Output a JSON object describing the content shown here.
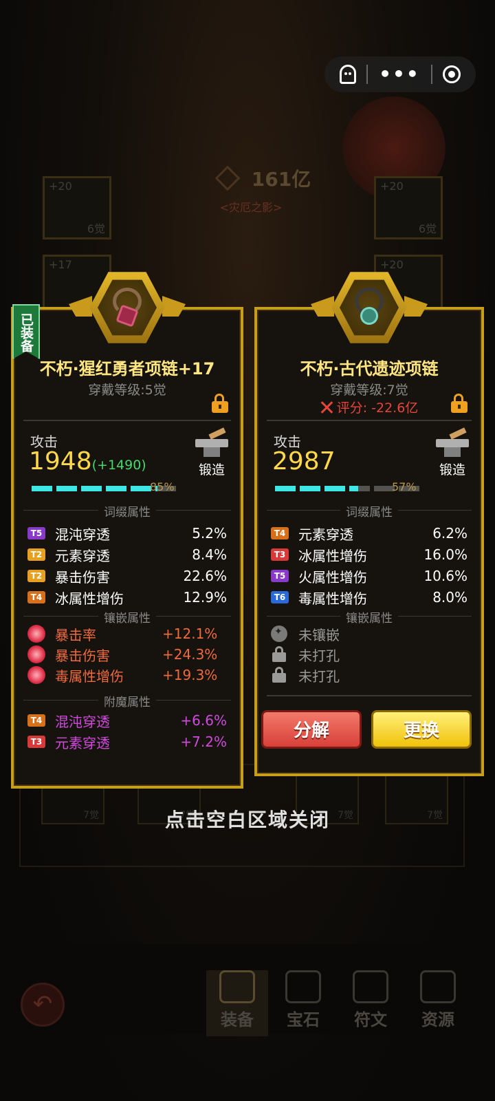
{
  "system_capsule": {
    "ghost": "ghost-icon",
    "more": "•••",
    "target": "target-icon"
  },
  "background": {
    "power_value": "161亿",
    "title": "<灾厄之影>",
    "slots": [
      {
        "level": "+20",
        "jue": "6觉"
      },
      {
        "level": "+20",
        "jue": "6觉"
      },
      {
        "level": "+17",
        "jue": ""
      },
      {
        "level": "+20",
        "jue": ""
      }
    ],
    "bottom_slots": [
      {
        "jue": "7觉"
      },
      {
        "jue": "7觉"
      },
      {
        "jue": "7觉"
      },
      {
        "jue": "7觉"
      }
    ]
  },
  "left_card": {
    "equipped_tag": "已装备",
    "name": "不朽·猩红勇者项链+17",
    "wear_level": "穿戴等级:5觉",
    "attack_label": "攻击",
    "attack_value": "1948",
    "attack_bonus": "(+1490)",
    "forge_label": "锻造",
    "progress_percent": 85,
    "progress_text": "85%",
    "affix_title": "词缀属性",
    "affixes": [
      {
        "tier": "T5",
        "tier_color": "#8a3ac8",
        "name": "混沌穿透",
        "value": "5.2%"
      },
      {
        "tier": "T2",
        "tier_color": "#e8a020",
        "name": "元素穿透",
        "value": "8.4%"
      },
      {
        "tier": "T2",
        "tier_color": "#e8a020",
        "name": "暴击伤害",
        "value": "22.6%"
      },
      {
        "tier": "T4",
        "tier_color": "#d8701a",
        "name": "冰属性增伤",
        "value": "12.9%"
      }
    ],
    "inlay_title": "镶嵌属性",
    "inlays": [
      {
        "name": "暴击率",
        "value": "+12.1%"
      },
      {
        "name": "暴击伤害",
        "value": "+24.3%"
      },
      {
        "name": "毒属性增伤",
        "value": "+19.3%"
      }
    ],
    "enchant_title": "附魔属性",
    "enchants": [
      {
        "tier": "T4",
        "tier_color": "#d8701a",
        "name": "混沌穿透",
        "value": "+6.6%"
      },
      {
        "tier": "T3",
        "tier_color": "#d83a3a",
        "name": "元素穿透",
        "value": "+7.2%"
      }
    ]
  },
  "right_card": {
    "name": "不朽·古代遗迹项链",
    "wear_level": "穿戴等级:7觉",
    "score": "评分: -22.6亿",
    "attack_label": "攻击",
    "attack_value": "2987",
    "forge_label": "锻造",
    "progress_percent": 57,
    "progress_text": "57%",
    "affix_title": "词缀属性",
    "affixes": [
      {
        "tier": "T4",
        "tier_color": "#d8701a",
        "name": "元素穿透",
        "value": "6.2%"
      },
      {
        "tier": "T3",
        "tier_color": "#d83a3a",
        "name": "冰属性增伤",
        "value": "16.0%"
      },
      {
        "tier": "T5",
        "tier_color": "#8a3ac8",
        "name": "火属性增伤",
        "value": "10.6%"
      },
      {
        "tier": "T6",
        "tier_color": "#2a6ad8",
        "name": "毒属性增伤",
        "value": "8.0%"
      }
    ],
    "inlay_title": "镶嵌属性",
    "inlays": [
      {
        "name": "未镶嵌"
      },
      {
        "name": "未打孔"
      },
      {
        "name": "未打孔"
      }
    ],
    "decompose_label": "分解",
    "replace_label": "更换"
  },
  "close_hint": "点击空白区域关闭",
  "bottom_nav": [
    {
      "label": "装备"
    },
    {
      "label": "宝石"
    },
    {
      "label": "符文"
    },
    {
      "label": "资源"
    }
  ]
}
